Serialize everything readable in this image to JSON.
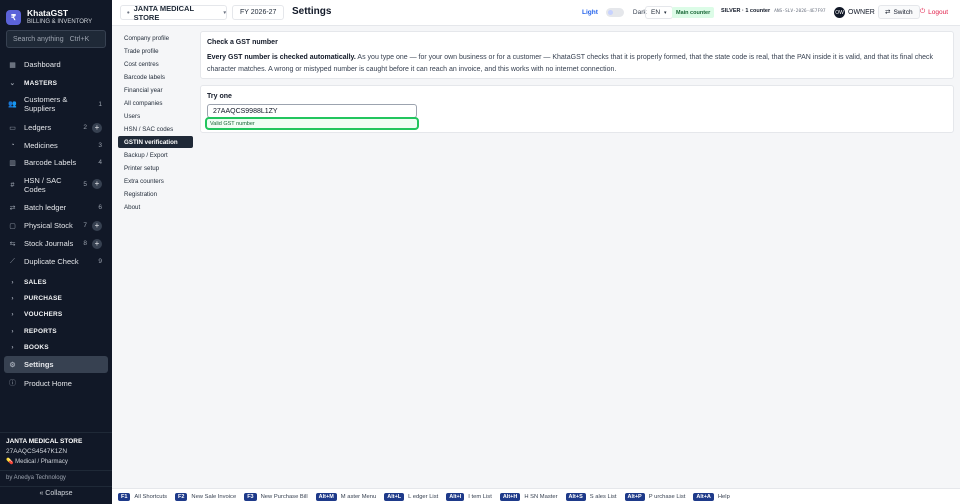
{
  "brand": {
    "logo": "₹",
    "name": "KhataGST",
    "subtitle": "BILLING & INVENTORY"
  },
  "search": {
    "placeholder": "Search anything",
    "shortcut": "Ctrl+K"
  },
  "sidebar": {
    "dashboard": "Dashboard",
    "masters_header": "MASTERS",
    "items": [
      {
        "label": "Customers & Suppliers",
        "count": "1",
        "plus": false,
        "icon": "users-icon"
      },
      {
        "label": "Ledgers",
        "count": "2",
        "plus": true,
        "icon": "book-icon"
      },
      {
        "label": "Medicines",
        "count": "3",
        "plus": false,
        "icon": "pill-icon"
      },
      {
        "label": "Barcode Labels",
        "count": "4",
        "plus": false,
        "icon": "barcode-icon"
      },
      {
        "label": "HSN / SAC Codes",
        "count": "5",
        "plus": true,
        "icon": "hash-icon"
      },
      {
        "label": "Batch ledger",
        "count": "6",
        "plus": false,
        "icon": "batch-icon"
      },
      {
        "label": "Physical Stock",
        "count": "7",
        "plus": true,
        "icon": "box-icon"
      },
      {
        "label": "Stock Journals",
        "count": "8",
        "plus": true,
        "icon": "journal-icon"
      },
      {
        "label": "Duplicate Check",
        "count": "9",
        "plus": false,
        "icon": "wand-icon"
      }
    ],
    "sections": [
      "SALES",
      "PURCHASE",
      "VOUCHERS",
      "REPORTS",
      "BOOKS"
    ],
    "settings": "Settings",
    "product_home": "Product Home",
    "store_name": "JANTA MEDICAL STORE",
    "store_gstin": "27AAQCS4547K1ZN",
    "store_type": "Medical / Pharmacy",
    "by": "by Anedya Technology",
    "collapse": "« Collapse"
  },
  "topbar": {
    "store": "JANTA MEDICAL STORE",
    "fy": "FY 2026-27",
    "title": "Settings",
    "light": "Light",
    "dark": "Dark",
    "lang": "EN",
    "counter": "Main counter",
    "license_tier": "SILVER · 1 counter",
    "license_key": "ANS-SLV-2026-4E7F97",
    "owner_initials": "OW",
    "owner": "OWNER",
    "switch": "Switch",
    "logout": "Logout"
  },
  "subnav": {
    "items": [
      "Company profile",
      "Trade profile",
      "Cost centres",
      "Barcode labels",
      "Financial year",
      "All companies",
      "Users",
      "HSN / SAC codes",
      "GSTIN verification",
      "Backup / Export",
      "Printer setup",
      "Extra counters",
      "Registration",
      "About"
    ],
    "active_index": 8
  },
  "main": {
    "card1_title": "Check a GST number",
    "card1_bold": "Every GST number is checked automatically.",
    "card1_text": " As you type one — for your own business or for a customer — KhataGST checks that it is properly formed, that the state code is real, that the PAN inside it is valid, and that its final check character matches. A wrong or mistyped number is caught before it can reach an invoice, and this works with no internet connection.",
    "card2_title": "Try one",
    "gst_value": "27AAQCS9988L1ZY",
    "status": "Valid GST number"
  },
  "shortcuts": [
    {
      "key": "F1",
      "label": "All Shortcuts"
    },
    {
      "key": "F2",
      "label": "New Sale Invoice"
    },
    {
      "key": "F3",
      "label": "New Purchase Bill"
    },
    {
      "key": "Alt+M",
      "label": "M aster Menu"
    },
    {
      "key": "Alt+L",
      "label": "L edger List"
    },
    {
      "key": "Alt+I",
      "label": "I tem List"
    },
    {
      "key": "Alt+H",
      "label": "H SN Master"
    },
    {
      "key": "Alt+S",
      "label": "S ales List"
    },
    {
      "key": "Alt+P",
      "label": "P urchase List"
    },
    {
      "key": "Alt+A",
      "label": "Help"
    }
  ]
}
